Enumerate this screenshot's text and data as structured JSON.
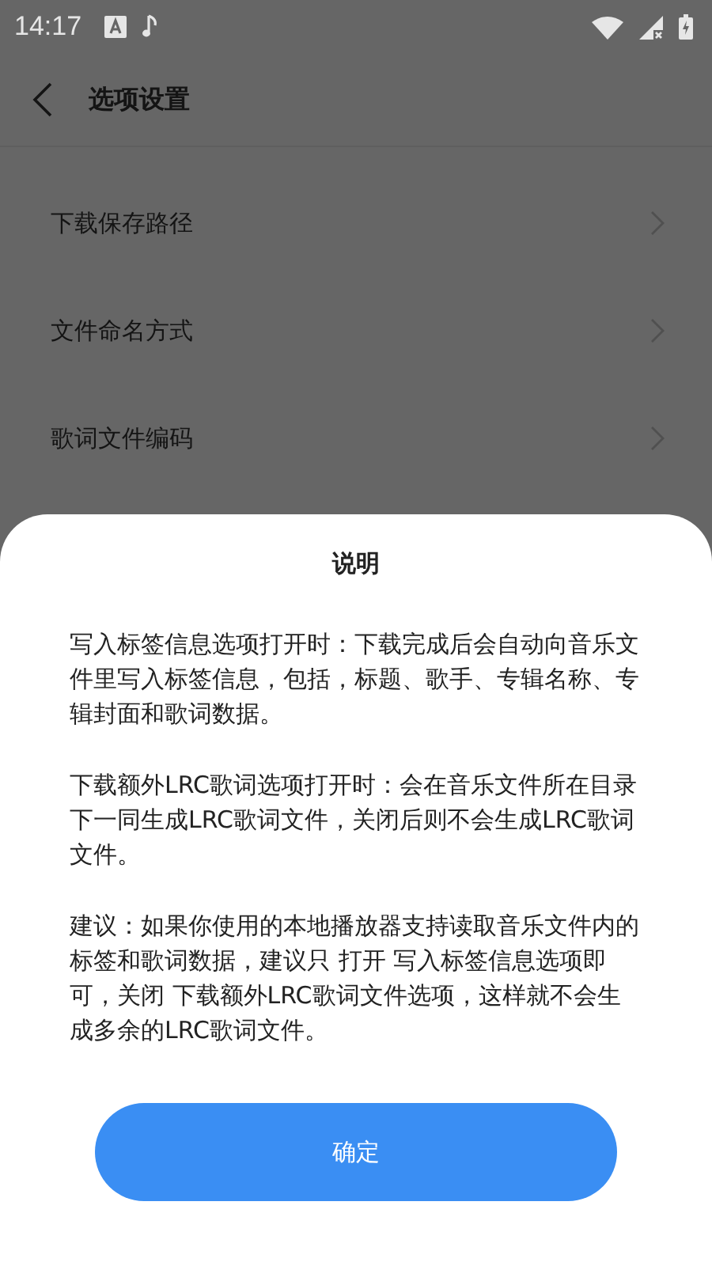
{
  "status_bar": {
    "time": "14:17"
  },
  "app_bar": {
    "title": "选项设置"
  },
  "settings": [
    {
      "label": "下载保存路径"
    },
    {
      "label": "文件命名方式"
    },
    {
      "label": "歌词文件编码"
    }
  ],
  "dialog": {
    "title": "说明",
    "paragraphs": [
      "写入标签信息选项打开时：下载完成后会自动向音乐文件里写入标签信息，包括，标题、歌手、专辑名称、专辑封面和歌词数据。",
      "下载额外LRC歌词选项打开时：会在音乐文件所在目录下一同生成LRC歌词文件，关闭后则不会生成LRC歌词文件。",
      "建议：如果你使用的本地播放器支持读取音乐文件内的标签和歌词数据，建议只 打开 写入标签信息选项即可，关闭 下载额外LRC歌词文件选项，这样就不会生成多余的LRC歌词文件。"
    ],
    "button": "确定"
  }
}
